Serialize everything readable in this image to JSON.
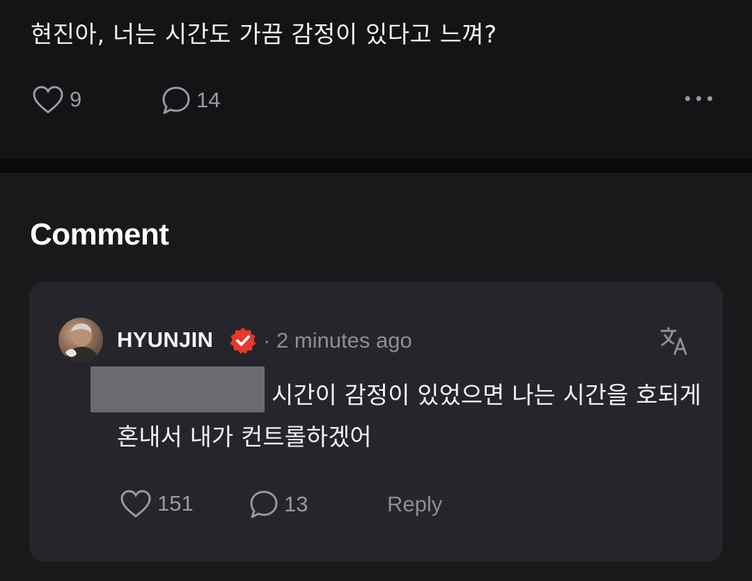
{
  "post": {
    "text": "현진아, 너는 시간도 가끔 감정이 있다고 느껴?",
    "like_icon": "heart-icon",
    "like_count": "9",
    "comment_icon": "speech-bubble-icon",
    "comment_count": "14",
    "more_icon": "more-horizontal-icon"
  },
  "comments_section": {
    "title": "Comment",
    "comment": {
      "author": "HYUNJIN",
      "verified_icon": "verified-badge-icon",
      "verified_color": "#e53a2e",
      "separator": "·",
      "timestamp": "2 minutes ago",
      "translate_icon": "translate-icon",
      "text": "시간이 감정이 있었으면 나는 시간을 호되게 혼내서 내가 컨트롤하겠어",
      "like_count": "151",
      "reply_count": "13",
      "reply_label": "Reply"
    }
  },
  "colors": {
    "background": "#141417",
    "card": "#25252b",
    "muted_text": "#8e8e97"
  }
}
